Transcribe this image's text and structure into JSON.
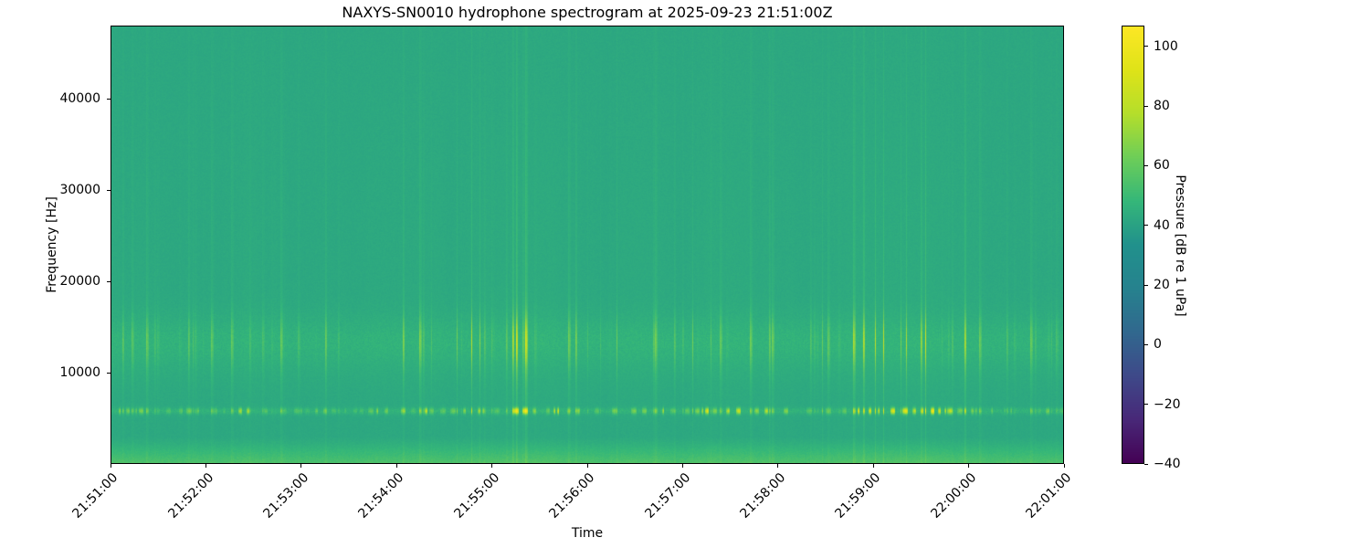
{
  "chart_data": {
    "type": "heatmap",
    "subtype": "spectrogram",
    "title": "NAXYS-SN0010 hydrophone spectrogram at 2025-09-23 21:51:00Z",
    "xlabel": "Time",
    "ylabel": "Frequency [Hz]",
    "x_tick_labels": [
      "21:51:00",
      "21:52:00",
      "21:53:00",
      "21:54:00",
      "21:55:00",
      "21:56:00",
      "21:57:00",
      "21:58:00",
      "21:59:00",
      "22:00:00",
      "22:01:00"
    ],
    "y_ticks": [
      {
        "value": 10000,
        "label": "10000"
      },
      {
        "value": 20000,
        "label": "20000"
      },
      {
        "value": 30000,
        "label": "30000"
      },
      {
        "value": 40000,
        "label": "40000"
      }
    ],
    "ylim": [
      0,
      48000
    ],
    "grid": false,
    "legend": "none",
    "colormap": "viridis",
    "colorbar": {
      "label": "Pressure [dB re 1 uPa]",
      "vmin": -40,
      "vmax": 107,
      "ticks": [
        {
          "value": 100,
          "label": "100"
        },
        {
          "value": 80,
          "label": "80"
        },
        {
          "value": 60,
          "label": "60"
        },
        {
          "value": 40,
          "label": "40"
        },
        {
          "value": 20,
          "label": "20"
        },
        {
          "value": 0,
          "label": "0"
        },
        {
          "value": -20,
          "label": "−20"
        },
        {
          "value": -40,
          "label": "−40"
        }
      ]
    },
    "noise_floor_db": 42,
    "features": [
      {
        "name": "tonal-band",
        "center_hz": 5800,
        "bandwidth_hz": 600,
        "peak_db": 105,
        "pattern": "intermittent bright pulses"
      },
      {
        "name": "click-band",
        "freq_range_hz": [
          11000,
          16000
        ],
        "peak_db": 76,
        "pattern": "dense vertical striping"
      },
      {
        "name": "low-frequency-noise",
        "freq_range_hz": [
          0,
          3000
        ],
        "level_db": 52,
        "pattern": "elevated continuous band"
      },
      {
        "name": "broadband-clicks",
        "freq_range_hz": [
          0,
          48000
        ],
        "peak_db": 49,
        "pattern": "faint full-height vertical streaks"
      }
    ]
  }
}
